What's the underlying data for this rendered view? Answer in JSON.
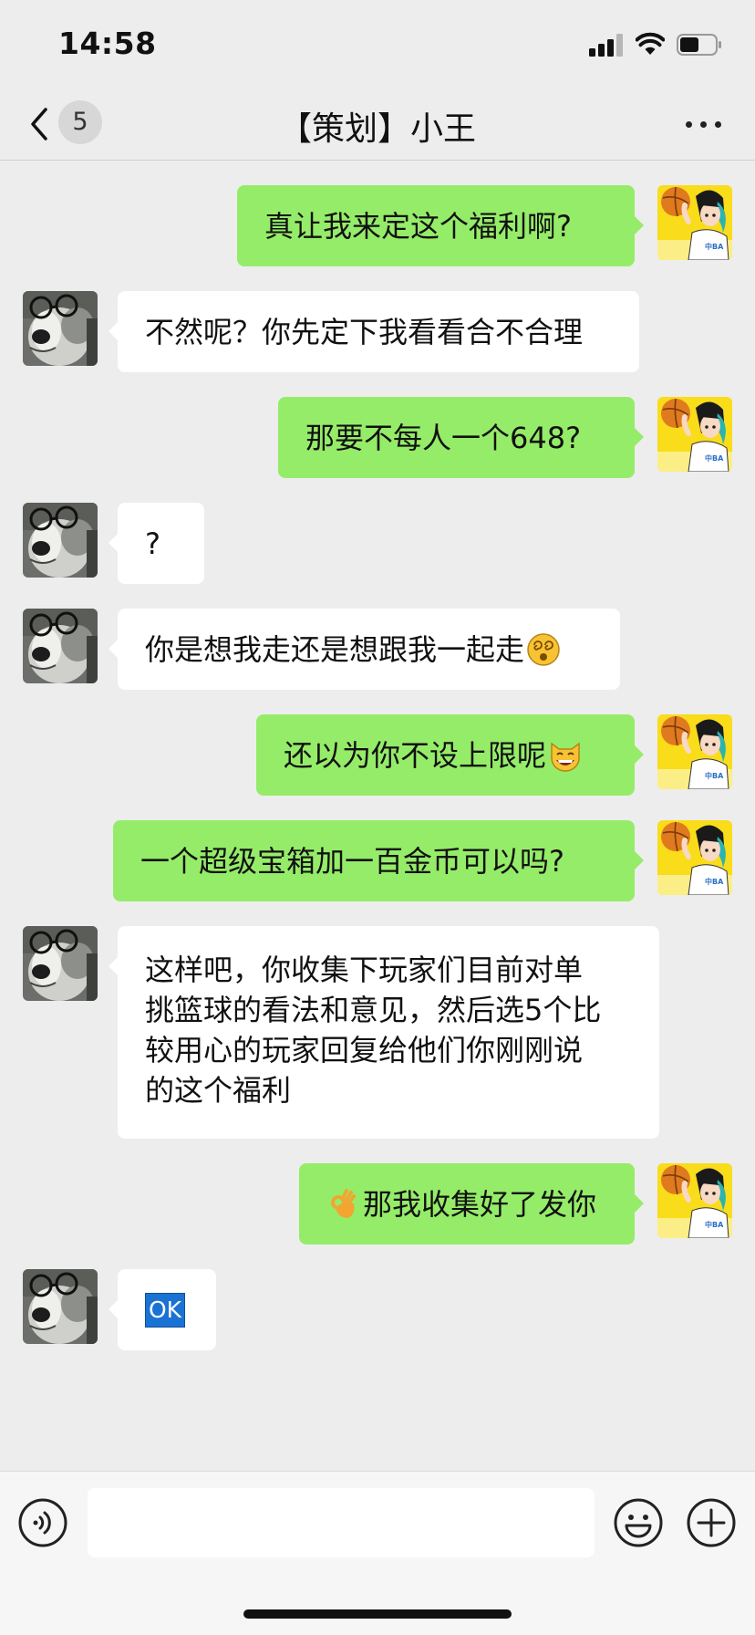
{
  "status_bar": {
    "time": "14:58",
    "icons": [
      "signal-icon",
      "wifi-icon",
      "battery-icon"
    ]
  },
  "nav": {
    "unread_count": "5",
    "title": "【策划】小王",
    "icons": [
      "back-chevron-icon",
      "more-icon"
    ]
  },
  "messages": [
    {
      "side": "right",
      "text": "真让我来定这个福利啊?"
    },
    {
      "side": "left",
      "text": "不然呢？你先定下我看看合不合理"
    },
    {
      "side": "right",
      "text": "那要不每人一个648?"
    },
    {
      "side": "left",
      "text": "?"
    },
    {
      "side": "left",
      "text": "你是想我走还是想跟我一起走",
      "emoji": "dizzy-face-icon"
    },
    {
      "side": "right",
      "text": "还以为你不设上限呢",
      "emoji": "grinning-cat-icon"
    },
    {
      "side": "right",
      "text": "一个超级宝箱加一百金币可以吗?"
    },
    {
      "side": "left",
      "lines": [
        "这样吧，你收集下玩家们目前对单",
        "挑篮球的看法和意见，然后选5个比",
        "较用心的玩家回复给他们你刚刚说",
        "的这个福利"
      ]
    },
    {
      "side": "right",
      "text": "那我收集好了发你",
      "emoji": "ok-hand-icon"
    },
    {
      "side": "left",
      "text": "OK",
      "emoji": "ok-button-icon"
    }
  ],
  "input_bar": {
    "placeholder": "",
    "icons": [
      "voice-icon",
      "emoji-icon",
      "plus-icon"
    ]
  },
  "colors": {
    "background": "#ededed",
    "self_bubble": "#95ec69",
    "other_bubble": "#ffffff"
  }
}
